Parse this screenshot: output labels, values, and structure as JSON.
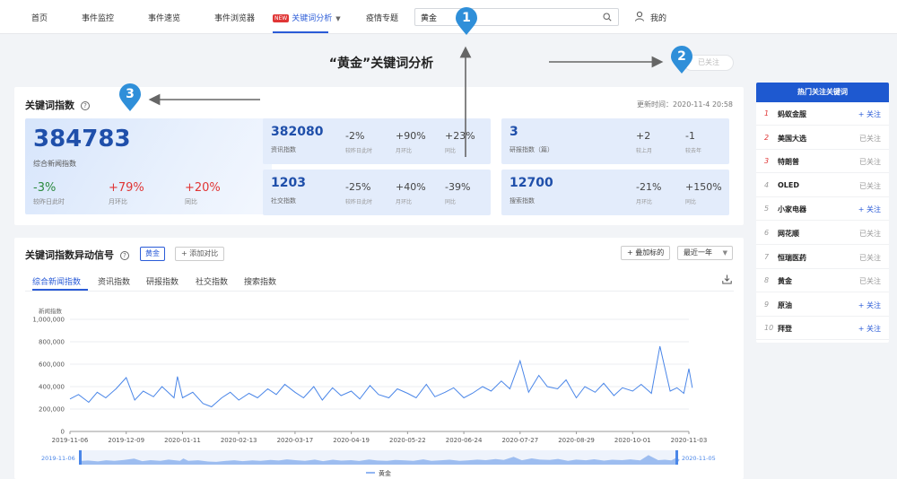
{
  "nav": {
    "items": [
      "首页",
      "事件监控",
      "事件速览",
      "事件浏览器"
    ],
    "new_badge": "NEW",
    "active_item": "关键词分析",
    "epidemic": "疫情专题",
    "search_value": "黄金",
    "user": "我的"
  },
  "title_row": {
    "page_title": "“黄金”关键词分析",
    "follow_button": "已关注"
  },
  "index_card": {
    "title": "关键词指数",
    "update_time": "更新时间：2020-11-4 20:58",
    "main": {
      "value": "384783",
      "label": "综合新闻指数",
      "stats": [
        {
          "value": "-3%",
          "label": "较昨日此时",
          "color": "#2b8a3e"
        },
        {
          "value": "+79%",
          "label": "月环比",
          "color": "#e03535"
        },
        {
          "value": "+20%",
          "label": "同比",
          "color": "#e03535"
        }
      ]
    },
    "tiles": [
      {
        "value": "382080",
        "label": "资讯指数",
        "stats": [
          {
            "value": "-2%",
            "label": "较昨日此时"
          },
          {
            "value": "+90%",
            "label": "月环比"
          },
          {
            "value": "+23%",
            "label": "同比"
          }
        ]
      },
      {
        "value": "3",
        "label": "研报指数（篇）",
        "stats": [
          {
            "value": "+2",
            "label": "较上月"
          },
          {
            "value": "-1",
            "label": "较去年"
          }
        ]
      },
      {
        "value": "1203",
        "label": "社交指数",
        "stats": [
          {
            "value": "-25%",
            "label": "较昨日此时"
          },
          {
            "value": "+40%",
            "label": "月环比"
          },
          {
            "value": "-39%",
            "label": "同比"
          }
        ]
      },
      {
        "value": "12700",
        "label": "搜索指数",
        "stats": [
          {
            "value": "-21%",
            "label": "月环比"
          },
          {
            "value": "+150%",
            "label": "同比"
          }
        ]
      }
    ]
  },
  "signal_card": {
    "title": "关键词指数异动信号",
    "keyword_tag": "黄金",
    "add_compare": "+ 添加对比",
    "add_indicator": "+ 叠加标的",
    "range": "最近一年",
    "tabs": [
      "综合新闻指数",
      "资讯指数",
      "研报指数",
      "社交指数",
      "搜索指数"
    ],
    "active_tab": 0,
    "range_start": "2019-11-06",
    "range_end": "2020-11-05"
  },
  "chart_data": {
    "type": "line",
    "ylabel": "新闻指数",
    "ylim": [
      0,
      1000000
    ],
    "y_ticks": [
      "0",
      "200,000",
      "400,000",
      "600,000",
      "800,000",
      "1,000,000"
    ],
    "x_ticks": [
      "2019-11-06",
      "2019-12-09",
      "2020-01-11",
      "2020-02-13",
      "2020-03-17",
      "2020-04-19",
      "2020-05-22",
      "2020-06-24",
      "2020-07-27",
      "2020-08-29",
      "2020-10-01",
      "2020-11-03"
    ],
    "series": [
      {
        "name": "黄金",
        "x": [
          "2019-11-06",
          "2019-11-11",
          "2019-11-17",
          "2019-11-22",
          "2019-11-27",
          "2019-12-03",
          "2019-12-09",
          "2019-12-14",
          "2019-12-19",
          "2019-12-25",
          "2019-12-30",
          "2020-01-06",
          "2020-01-08",
          "2020-01-11",
          "2020-01-17",
          "2020-01-23",
          "2020-01-28",
          "2020-02-03",
          "2020-02-08",
          "2020-02-13",
          "2020-02-19",
          "2020-02-24",
          "2020-03-01",
          "2020-03-06",
          "2020-03-11",
          "2020-03-17",
          "2020-03-22",
          "2020-03-28",
          "2020-04-02",
          "2020-04-08",
          "2020-04-13",
          "2020-04-19",
          "2020-04-24",
          "2020-04-30",
          "2020-05-05",
          "2020-05-11",
          "2020-05-16",
          "2020-05-22",
          "2020-05-27",
          "2020-06-02",
          "2020-06-07",
          "2020-06-13",
          "2020-06-18",
          "2020-06-24",
          "2020-06-29",
          "2020-07-05",
          "2020-07-10",
          "2020-07-16",
          "2020-07-21",
          "2020-07-27",
          "2020-08-01",
          "2020-08-07",
          "2020-08-12",
          "2020-08-18",
          "2020-08-23",
          "2020-08-29",
          "2020-09-03",
          "2020-09-09",
          "2020-09-14",
          "2020-09-20",
          "2020-09-25",
          "2020-10-01",
          "2020-10-06",
          "2020-10-12",
          "2020-10-17",
          "2020-10-23",
          "2020-10-27",
          "2020-10-31",
          "2020-11-03",
          "2020-11-05"
        ],
        "values": [
          290000,
          330000,
          260000,
          350000,
          300000,
          380000,
          480000,
          280000,
          360000,
          310000,
          400000,
          300000,
          490000,
          300000,
          350000,
          250000,
          220000,
          300000,
          350000,
          280000,
          340000,
          300000,
          380000,
          330000,
          420000,
          350000,
          300000,
          400000,
          280000,
          390000,
          320000,
          360000,
          290000,
          410000,
          330000,
          300000,
          380000,
          340000,
          300000,
          420000,
          310000,
          350000,
          390000,
          300000,
          340000,
          400000,
          360000,
          450000,
          380000,
          630000,
          350000,
          500000,
          400000,
          380000,
          460000,
          300000,
          400000,
          350000,
          430000,
          320000,
          390000,
          360000,
          420000,
          340000,
          760000,
          360000,
          390000,
          340000,
          560000,
          390000
        ]
      }
    ]
  },
  "hot_keywords": {
    "title": "热门关注关键词",
    "items": [
      {
        "rank": "1",
        "name": "蚂蚁金服",
        "action": "+ 关注",
        "followed": false
      },
      {
        "rank": "2",
        "name": "美国大选",
        "action": "已关注",
        "followed": true
      },
      {
        "rank": "3",
        "name": "特朗普",
        "action": "已关注",
        "followed": true
      },
      {
        "rank": "4",
        "name": "OLED",
        "action": "已关注",
        "followed": true
      },
      {
        "rank": "5",
        "name": "小家电器",
        "action": "+ 关注",
        "followed": false
      },
      {
        "rank": "6",
        "name": "网花顺",
        "action": "已关注",
        "followed": true
      },
      {
        "rank": "7",
        "name": "恒瑞医药",
        "action": "已关注",
        "followed": true
      },
      {
        "rank": "8",
        "name": "黄金",
        "action": "已关注",
        "followed": true
      },
      {
        "rank": "9",
        "name": "原油",
        "action": "+ 关注",
        "followed": false
      },
      {
        "rank": "10",
        "name": "拜登",
        "action": "+ 关注",
        "followed": false
      }
    ]
  },
  "callouts": [
    "1",
    "2",
    "3"
  ],
  "colors": {
    "accent": "#2a5bd7",
    "chart_line": "#4a86e8",
    "pin": "#2f8fd9",
    "up": "#e03535",
    "down": "#2b8a3e"
  }
}
